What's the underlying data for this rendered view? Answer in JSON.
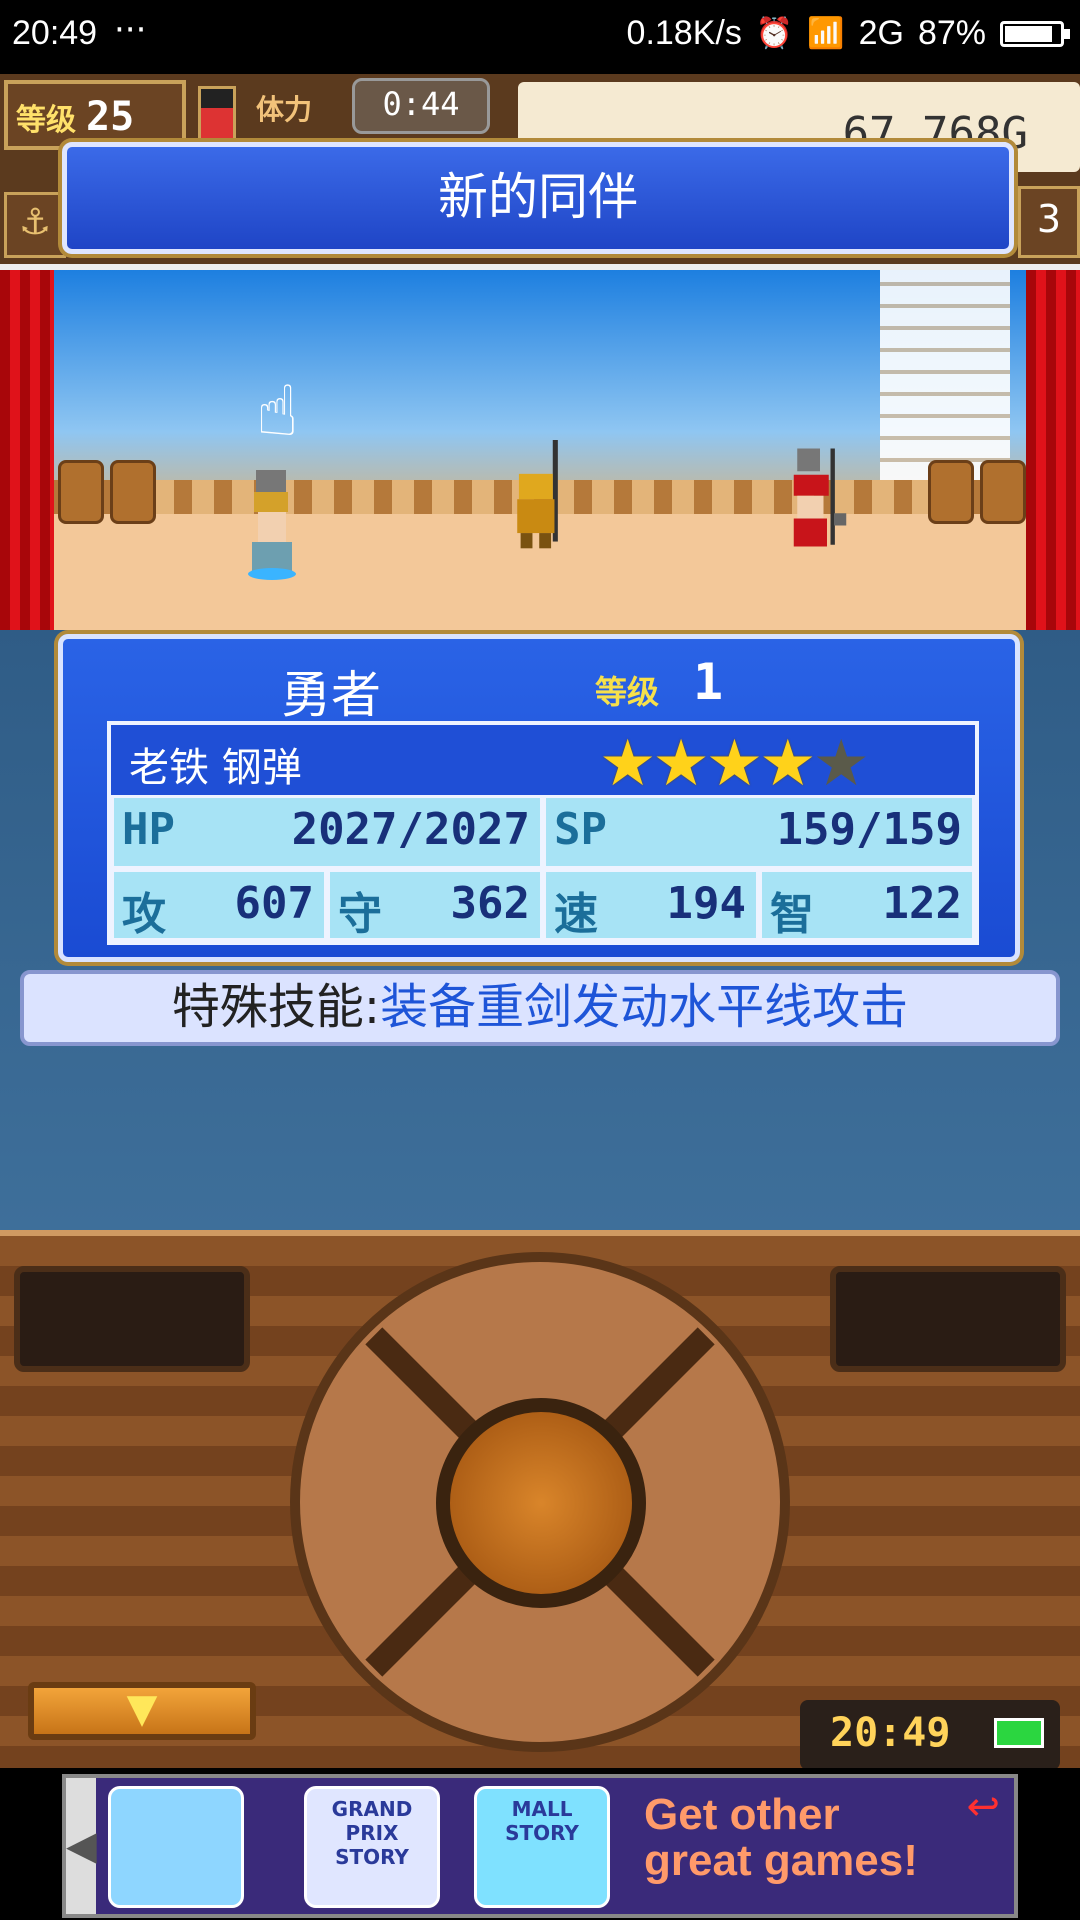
{
  "status_bar": {
    "time": "20:49",
    "dots": "···",
    "net_speed": "0.18K/s",
    "signal_label": "2G",
    "battery_pct": "87%",
    "battery_level": 0.87
  },
  "hud": {
    "level_label": "等级",
    "level_value": "25",
    "stamina_label": "体力",
    "timer": "0:44",
    "gold": "67,768G",
    "right_number": "3"
  },
  "banner": {
    "title": "新的同伴"
  },
  "card": {
    "job": "勇者",
    "level_label": "等级",
    "level_value": "1",
    "name": "老铁 钢弹",
    "stars_filled": 4,
    "stars_total": 5,
    "hp_label": "HP",
    "hp_value": "2027/2027",
    "sp_label": "SP",
    "sp_value": "159/159",
    "atk_label": "攻",
    "atk_value": "607",
    "def_label": "守",
    "def_value": "362",
    "spd_label": "速",
    "spd_value": "194",
    "int_label": "智",
    "int_value": "122"
  },
  "skill": {
    "label": "特殊技能:",
    "value": "装备重剑发动水平线攻击"
  },
  "controller": {
    "clock": "20:49",
    "drop_glyph": "▼"
  },
  "ads": {
    "tile1": "",
    "tile2": "GRAND PRIX STORY",
    "tile3": "MALL STORY",
    "get_more_1": "Get other",
    "get_more_2": "great games!"
  },
  "colors": {
    "banner_blue": "#2a5ee0",
    "gold_star": "#ffd21a",
    "skill_blue": "#1e55d8"
  },
  "icons": [
    "alarm-icon",
    "wifi-icon",
    "signal-icon",
    "battery-icon",
    "anchor-icon",
    "pointer-hand-icon",
    "star-icon",
    "back-arrow-icon"
  ]
}
